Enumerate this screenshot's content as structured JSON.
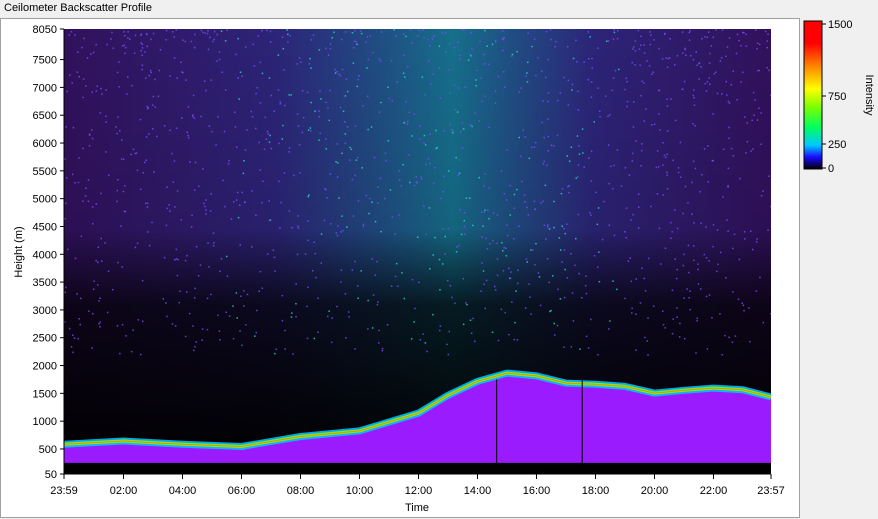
{
  "window": {
    "title": "Ceilometer Backscatter Profile"
  },
  "colors": {
    "background": "#000000",
    "aerosol": "#9b1bff",
    "noise_high": "#22e0c8",
    "noise_mid": "#7a4cff",
    "colormap": [
      "#000000",
      "#1a0aff",
      "#00c8ff",
      "#00ff60",
      "#7cff00",
      "#ffff00",
      "#ff8000",
      "#ff0000",
      "#ff0000"
    ]
  },
  "chart_data": {
    "type": "heatmap",
    "title": "Ceilometer Backscatter Profile",
    "xlabel": "Time",
    "ylabel": "Height (m)",
    "x_ticks": [
      "23:59",
      "02:00",
      "04:00",
      "06:00",
      "08:00",
      "10:00",
      "12:00",
      "14:00",
      "16:00",
      "18:00",
      "20:00",
      "22:00",
      "23:57"
    ],
    "y_ticks": [
      "50",
      "500",
      "1000",
      "1500",
      "2000",
      "2500",
      "3000",
      "3500",
      "4000",
      "4500",
      "5000",
      "5500",
      "6000",
      "6500",
      "7000",
      "7500",
      "8050"
    ],
    "ylim": [
      50,
      8050
    ],
    "xlim_hours": [
      -0.0167,
      23.95
    ],
    "colorbar": {
      "title": "Intensity",
      "ticks": [
        "1500",
        "750",
        "250",
        "0"
      ],
      "range": [
        0,
        1500
      ]
    },
    "boundary_layer_top_m": {
      "hours": [
        0,
        2,
        4,
        6,
        8,
        10,
        12,
        13,
        14,
        15,
        16,
        17,
        18,
        19,
        20,
        21,
        22,
        23,
        23.95
      ],
      "height": [
        620,
        680,
        620,
        580,
        760,
        860,
        1180,
        1500,
        1750,
        1900,
        1850,
        1720,
        1700,
        1660,
        1540,
        1590,
        1630,
        1600,
        1470
      ]
    },
    "vertical_lines_hours": [
      14.65,
      17.55
    ]
  }
}
